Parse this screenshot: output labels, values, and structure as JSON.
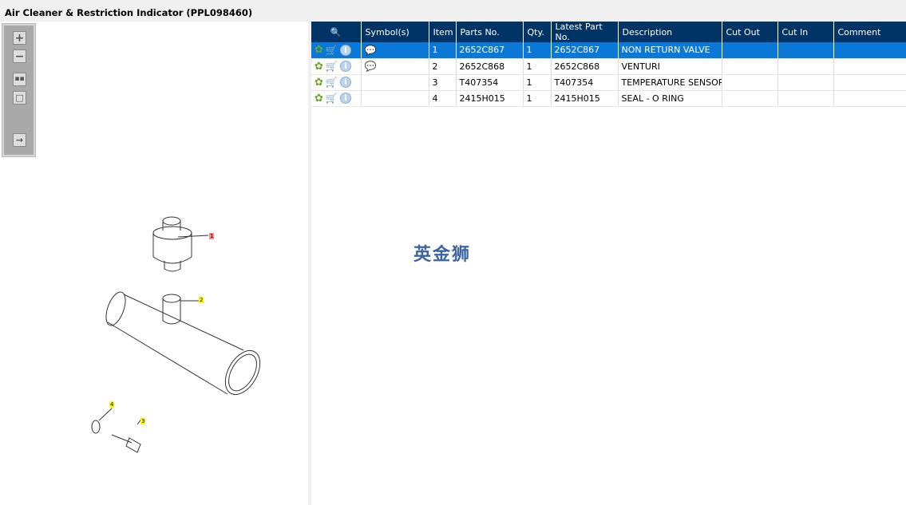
{
  "title": "Air Cleaner & Restriction Indicator (PPL098460)",
  "toolbar": [
    "zoom-in",
    "zoom-out",
    "fit-all",
    "actual-size",
    "toggle-panel"
  ],
  "grid": {
    "headers": [
      "",
      "Symbol(s)",
      "Item",
      "Parts No.",
      "Qty.",
      "Latest Part No.",
      "Description",
      "Cut Out",
      "Cut In",
      "Comment"
    ],
    "rows": [
      {
        "symbol": "note",
        "item": "1",
        "part": "2652C867",
        "qty": "1",
        "latest": "2652C867",
        "desc": "NON RETURN VALVE",
        "cut_out": "",
        "cut_in": "",
        "comment": "",
        "selected": true
      },
      {
        "symbol": "note",
        "item": "2",
        "part": "2652C868",
        "qty": "1",
        "latest": "2652C868",
        "desc": "VENTURI",
        "cut_out": "",
        "cut_in": "",
        "comment": ""
      },
      {
        "symbol": "",
        "item": "3",
        "part": "T407354",
        "qty": "1",
        "latest": "T407354",
        "desc": "TEMPERATURE SENSOR",
        "cut_out": "",
        "cut_in": "",
        "comment": ""
      },
      {
        "symbol": "",
        "item": "4",
        "part": "2415H015",
        "qty": "1",
        "latest": "2415H015",
        "desc": "SEAL - O RING",
        "cut_out": "",
        "cut_in": "",
        "comment": ""
      }
    ]
  },
  "diagram": {
    "callouts": [
      "1",
      "2",
      "3",
      "4"
    ]
  },
  "watermark": "英金狮",
  "colors": {
    "header": "#003366",
    "selected": "#0a78d7"
  }
}
